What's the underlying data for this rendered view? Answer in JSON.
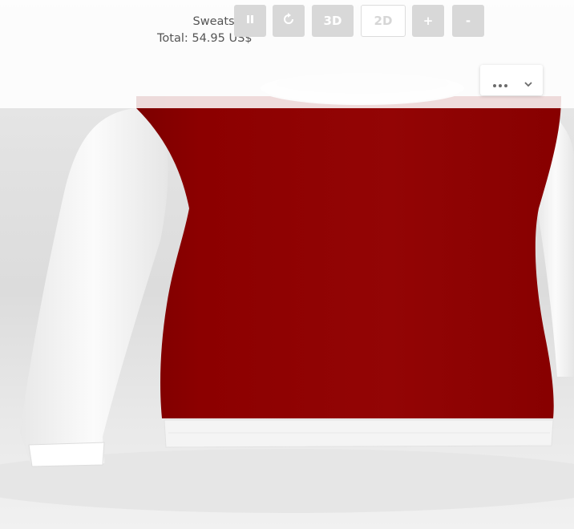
{
  "product": {
    "name": "Sweatshirt",
    "total_label": "Total:",
    "total_value": "54.95 US$"
  },
  "toolbar": {
    "buttons": [
      {
        "id": "pause",
        "icon": "pause-icon",
        "label": ""
      },
      {
        "id": "rotate",
        "icon": "rotate-icon",
        "label": ""
      },
      {
        "id": "view-3d",
        "icon": "",
        "label": "3D"
      },
      {
        "id": "view-2d",
        "icon": "",
        "label": "2D"
      },
      {
        "id": "zoom-in",
        "icon": "",
        "label": "+"
      },
      {
        "id": "zoom-out",
        "icon": "",
        "label": "-"
      }
    ]
  },
  "menu": {
    "icon": "more-horizontal-icon",
    "dropdown_icon": "chevron-down-icon"
  },
  "garment": {
    "body_color": "#8e0000",
    "sleeve_color": "#f6f6f6",
    "trim_color": "#f3f3f3",
    "accent_color": "#f2a800"
  }
}
